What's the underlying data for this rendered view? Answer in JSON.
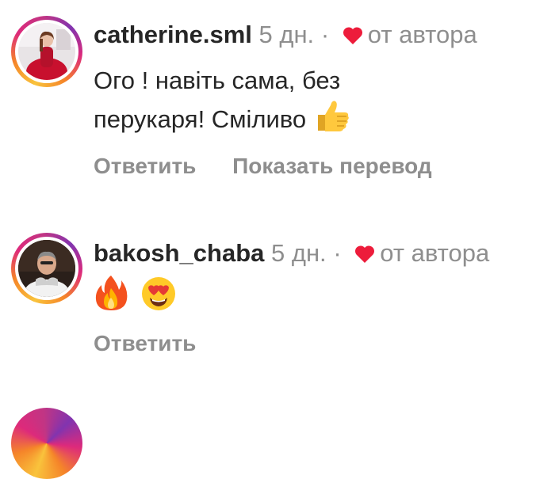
{
  "comments": [
    {
      "username": "catherine.sml",
      "time": "5 дн.",
      "separator": "·",
      "liked_label": "от автора",
      "text_line1": "Ого ! навіть сама, без",
      "text_line2": "перукаря! Сміливо",
      "text_emoji": "thumbs-up-emoji",
      "actions": {
        "reply": "Ответить",
        "translate": "Показать перевод"
      }
    },
    {
      "username": "bakosh_chaba",
      "time": "5 дн.",
      "separator": "·",
      "liked_label": "от автора",
      "text_emojis": [
        "fire-emoji",
        "heart-eyes-emoji"
      ],
      "actions": {
        "reply": "Ответить"
      }
    }
  ],
  "colors": {
    "heart": "#ed1c3b",
    "meta_text": "#8e8e8e",
    "body_text": "#262626"
  }
}
